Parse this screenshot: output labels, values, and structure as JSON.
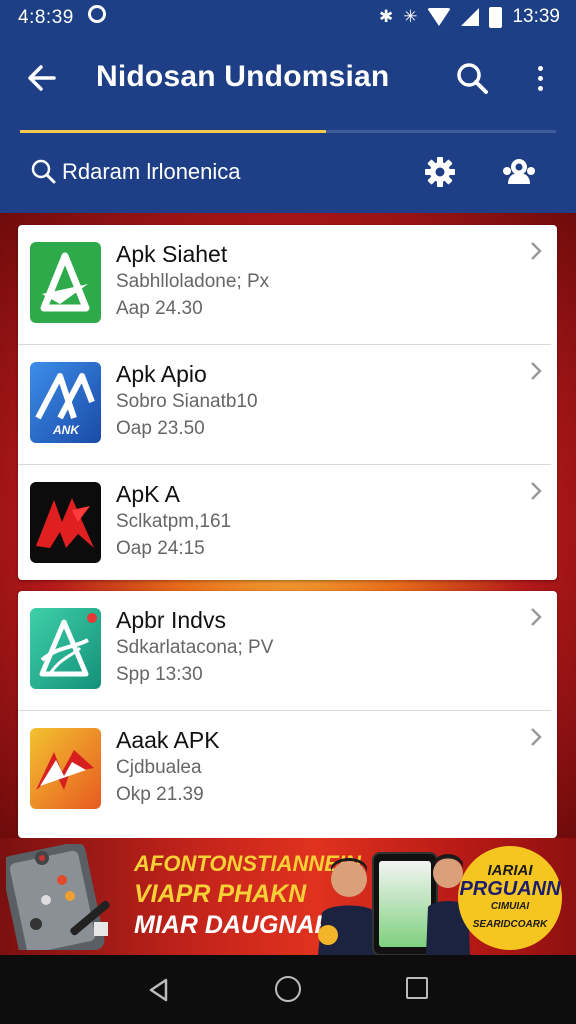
{
  "status_bar": {
    "time": "4:8:39",
    "right_text": "13:39",
    "icons": [
      "notification-icon",
      "bluetooth-icon",
      "alarm-icon",
      "wifi-icon",
      "signal-icon",
      "battery-icon"
    ]
  },
  "app_bar": {
    "title": "Nidosan Undomsian",
    "progress_fraction": 0.57,
    "search_placeholder": "Rdaram lrlonenica"
  },
  "cards": [
    {
      "items": [
        {
          "name": "Apk Siahet",
          "subtitle": "Sabhlloladone; Px",
          "date": "Aap 24.30",
          "icon": "apk-a-green-icon"
        },
        {
          "name": "Apk Apio",
          "subtitle": "Sobro Sianatb10",
          "date": "Oap 23.50",
          "icon": "apk-blue-icon",
          "icon_label": "ANK"
        },
        {
          "name": "ApK A",
          "subtitle": "Sclkatpm,161",
          "date": "Oap 24:15",
          "icon": "apk-red-black-icon"
        }
      ]
    },
    {
      "items": [
        {
          "name": "Apbr Indvs",
          "subtitle": "Sdkarlatacona; PV",
          "date": "Spp 13:30",
          "icon": "apk-teal-icon"
        },
        {
          "name": "Aaak APK",
          "subtitle": "Cjdbualea",
          "date": "Okp 21.39",
          "icon": "apk-orange-icon"
        }
      ]
    }
  ],
  "banner": {
    "line1": "AFONTONSTIANNEIN",
    "line2": "VIAPR PHAKN",
    "line3": "MIAR DAUGNAR!",
    "badge_line1": "IARIAI",
    "badge_line2": "PRGUANN",
    "badge_line3": "CIMUIAI",
    "badge_line4": "SEARIDCOARK"
  },
  "colors": {
    "app_bar": "#1e3f86",
    "accent": "#f2c94c",
    "banner": "#c5241b"
  }
}
